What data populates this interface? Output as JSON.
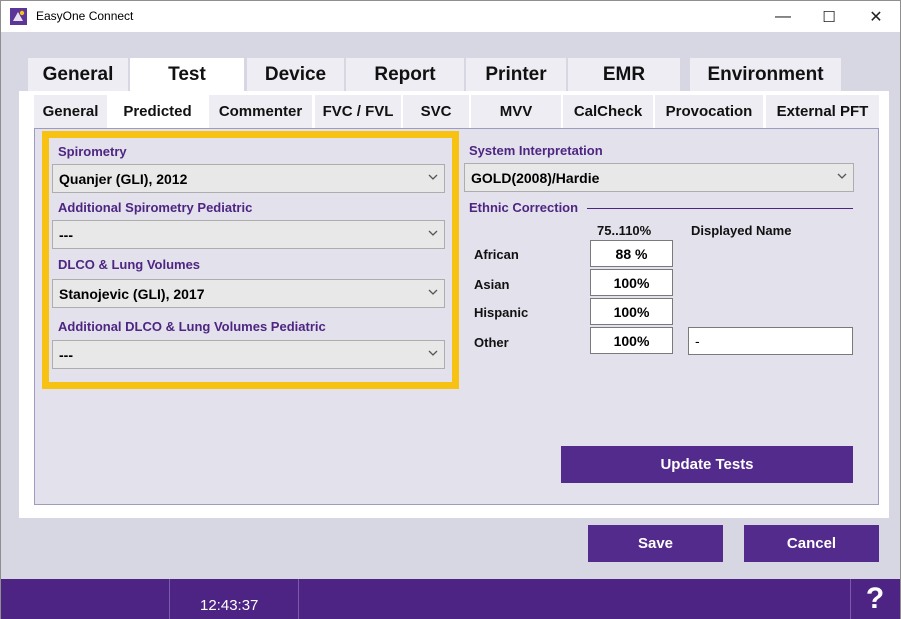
{
  "window": {
    "title": "EasyOne Connect",
    "controls": {
      "minimize": "—",
      "maximize": "☐",
      "close": "✕"
    }
  },
  "main_tabs": [
    {
      "label": "General"
    },
    {
      "label": "Test",
      "active": true
    },
    {
      "label": "Device"
    },
    {
      "label": "Report"
    },
    {
      "label": "Printer"
    },
    {
      "label": "EMR"
    },
    {
      "label": "Environment"
    }
  ],
  "sub_tabs": [
    {
      "label": "General"
    },
    {
      "label": "Predicted",
      "active": true
    },
    {
      "label": "Commenter"
    },
    {
      "label": "FVC / FVL"
    },
    {
      "label": "SVC"
    },
    {
      "label": "MVV"
    },
    {
      "label": "CalCheck"
    },
    {
      "label": "Provocation"
    },
    {
      "label": "External PFT"
    }
  ],
  "predicted": {
    "spirometry": {
      "label": "Spirometry",
      "value": "Quanjer (GLI), 2012"
    },
    "spirometry_pediatric": {
      "label": "Additional Spirometry Pediatric",
      "value": "---"
    },
    "dlco": {
      "label": "DLCO & Lung Volumes",
      "value": "Stanojevic (GLI), 2017"
    },
    "dlco_pediatric": {
      "label": "Additional DLCO & Lung Volumes Pediatric",
      "value": "---"
    }
  },
  "interpretation": {
    "label": "System Interpretation",
    "value": "GOLD(2008)/Hardie"
  },
  "ethnic": {
    "label": "Ethnic Correction",
    "col_range": "75..110%",
    "col_name": "Displayed Name",
    "rows": [
      {
        "name": "African",
        "value": "88 %"
      },
      {
        "name": "Asian",
        "value": "100%"
      },
      {
        "name": "Hispanic",
        "value": "100%"
      },
      {
        "name": "Other",
        "value": "100%",
        "displayed_name": "-"
      }
    ]
  },
  "buttons": {
    "update": "Update Tests",
    "save": "Save",
    "cancel": "Cancel"
  },
  "status": {
    "time": "12:43:37",
    "help": "?"
  },
  "colors": {
    "accent": "#532b8c",
    "highlight": "#f7c211",
    "label": "#4e2682"
  }
}
